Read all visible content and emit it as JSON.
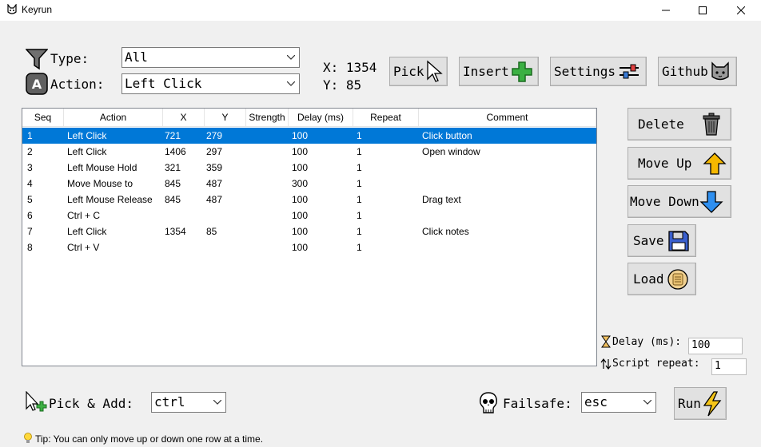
{
  "window": {
    "title": "Keyrun",
    "icon": "cat-icon",
    "minimize_glyph": "—",
    "maximize_glyph": "☐",
    "close_glyph": "✕"
  },
  "filters": {
    "type_label": "Type:",
    "type_value": "All",
    "action_label": "Action:",
    "action_value": "Left Click"
  },
  "coords": {
    "x_label": "X: 1354",
    "y_label": "Y: 85"
  },
  "toolbar": {
    "pick": "Pick",
    "insert": "Insert",
    "settings": "Settings",
    "github": "Github"
  },
  "table": {
    "headers": [
      "Seq",
      "Action",
      "X",
      "Y",
      "Strength",
      "Delay (ms)",
      "Repeat",
      "Comment"
    ],
    "selected_row": 0,
    "rows": [
      [
        "1",
        "Left Click",
        "721",
        "279",
        "",
        "100",
        "1",
        "Click button"
      ],
      [
        "2",
        "Left Click",
        "1406",
        "297",
        "",
        "100",
        "1",
        "Open window"
      ],
      [
        "3",
        "Left Mouse Hold",
        "321",
        "359",
        "",
        "100",
        "1",
        ""
      ],
      [
        "4",
        "Move Mouse to",
        "845",
        "487",
        "",
        "300",
        "1",
        ""
      ],
      [
        "5",
        "Left Mouse Release",
        "845",
        "487",
        "",
        "100",
        "1",
        "Drag text"
      ],
      [
        "6",
        "Ctrl + C",
        "",
        "",
        "",
        "100",
        "1",
        ""
      ],
      [
        "7",
        "Left Click",
        "1354",
        "85",
        "",
        "100",
        "1",
        "Click notes"
      ],
      [
        "8",
        "Ctrl + V",
        "",
        "",
        "",
        "100",
        "1",
        ""
      ]
    ]
  },
  "side_buttons": {
    "delete": "Delete",
    "move_up": "Move Up",
    "move_down": "Move Down",
    "save": "Save",
    "load": "Load"
  },
  "settings": {
    "delay_label": "Delay (ms):",
    "delay_value": "100",
    "repeat_label": "Script repeat:",
    "repeat_value": "1"
  },
  "bottom": {
    "pick_add_label": "Pick & Add:",
    "pick_add_value": "ctrl",
    "failsafe_label": "Failsafe:",
    "failsafe_value": "esc",
    "run": "Run"
  },
  "tip": "Tip: You can only move up or down one row at a time.",
  "colors": {
    "selection": "#0078d7",
    "accent_green": "#3cb043",
    "accent_yellow": "#f5b800",
    "accent_blue": "#2e8ff0"
  }
}
